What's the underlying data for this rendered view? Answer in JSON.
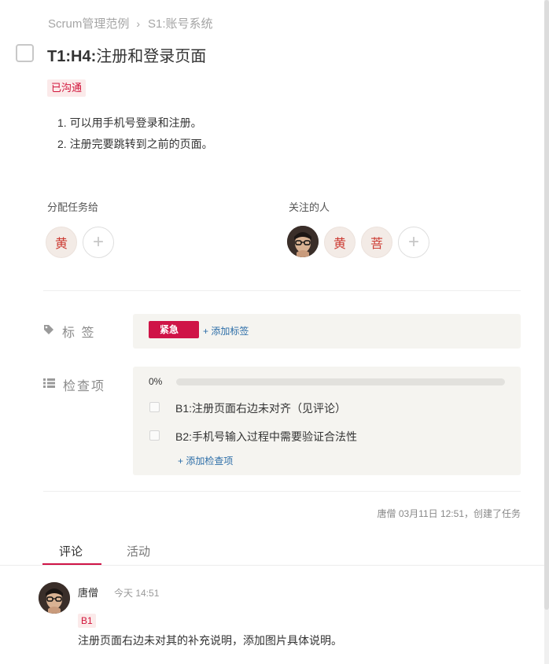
{
  "breadcrumb": {
    "project": "Scrum管理范例",
    "separator": "›",
    "story": "S1:账号系统"
  },
  "task": {
    "title_code": "T1:H4:",
    "title_text": "注册和登录页面",
    "status_tag": "已沟通",
    "description": [
      "1. 可以用手机号登录和注册。",
      "2. 注册完要跳转到之前的页面。"
    ]
  },
  "assignee": {
    "label": "分配任务给",
    "avatars": [
      "黄"
    ],
    "add_symbol": "+"
  },
  "followers": {
    "label": "关注的人",
    "avatars": [
      "黄",
      "菩"
    ],
    "add_symbol": "+"
  },
  "tags": {
    "label": "标 签",
    "items": [
      "紧急"
    ],
    "add_label": "+ 添加标签",
    "colors": {
      "urgent": "#cf1447"
    }
  },
  "checklist": {
    "label": "检查项",
    "progress_text": "0%",
    "progress": 0,
    "items": [
      "B1:注册页面右边未对齐（见评论）",
      "B2:手机号输入过程中需要验证合法性"
    ],
    "add_label": "+ 添加检查项"
  },
  "meta": "唐僧  03月11日 12:51，创建了任务",
  "tabs": {
    "comments": "评论",
    "activity": "活动"
  },
  "comment": {
    "author": "唐僧",
    "time": "今天 14:51",
    "tag": "B1",
    "body": "注册页面右边未对其的补充说明，添加图片具体说明。"
  }
}
